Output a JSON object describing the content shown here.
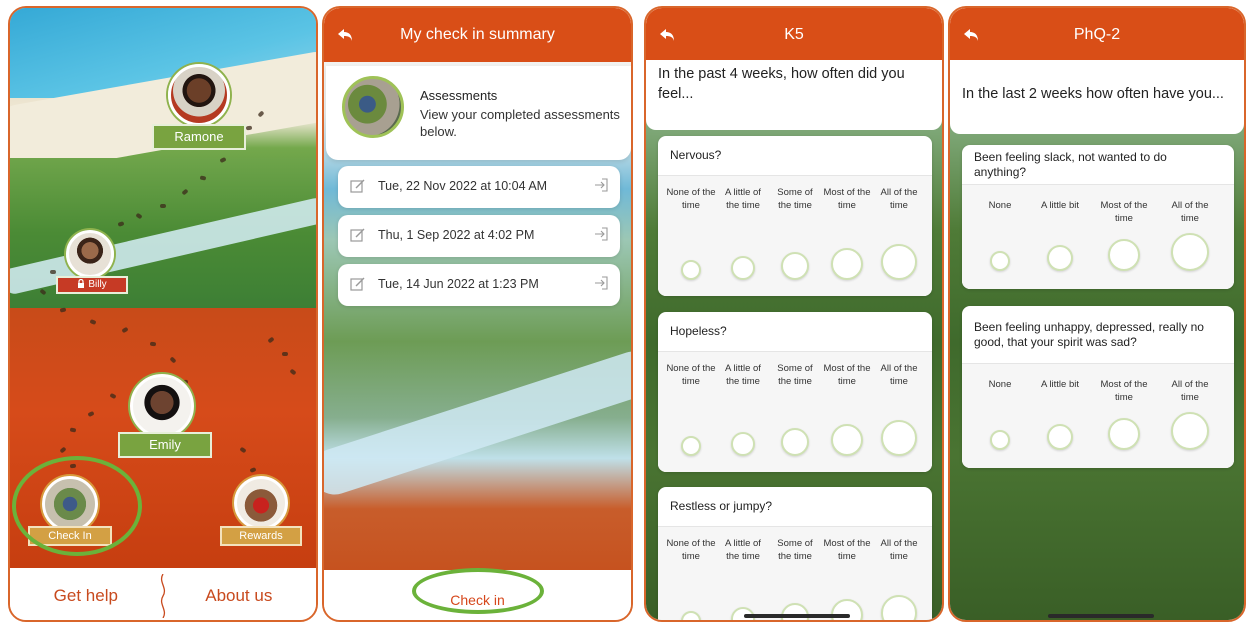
{
  "screen1": {
    "profiles": [
      {
        "name": "Ramone"
      },
      {
        "name": "Billy"
      },
      {
        "name": "Emily"
      }
    ],
    "checkin_label": "Check In",
    "rewards_label": "Rewards",
    "bottom": {
      "help": "Get help",
      "about": "About us"
    }
  },
  "screen2": {
    "title": "My check in summary",
    "assessments_title": "Assessments",
    "assessments_desc": "View your completed assessments below.",
    "entries": [
      "Tue, 22 Nov 2022 at 10:04 AM",
      "Thu, 1 Sep 2022 at 4:02 PM",
      "Tue, 14 Jun 2022 at 1:23 PM"
    ],
    "checkin_button": "Check in"
  },
  "screen3": {
    "title": "K5",
    "prompt": "In the past 4 weeks, how often did you feel...",
    "options": [
      "None of the time",
      "A little of the time",
      "Some of the time",
      "Most of the time",
      "All of the time"
    ],
    "questions": [
      "Nervous?",
      "Hopeless?",
      "Restless or jumpy?"
    ]
  },
  "screen4": {
    "title": "PhQ-2",
    "prompt": "In the last 2 weeks how often have you...",
    "options": [
      "None",
      "A little bit",
      "Most of the time",
      "All of the time"
    ],
    "questions": [
      "Been feeling slack, not wanted to do anything?",
      "Been feeling unhappy, depressed, really no good, that your spirit was sad?"
    ]
  },
  "colors": {
    "header": "#d94e17",
    "accent": "#c84a1e",
    "green_tag": "#79a340",
    "highlight": "#6bb23a"
  },
  "icons": [
    "back-arrow-icon",
    "edit-icon",
    "open-entry-icon",
    "lock-icon"
  ]
}
